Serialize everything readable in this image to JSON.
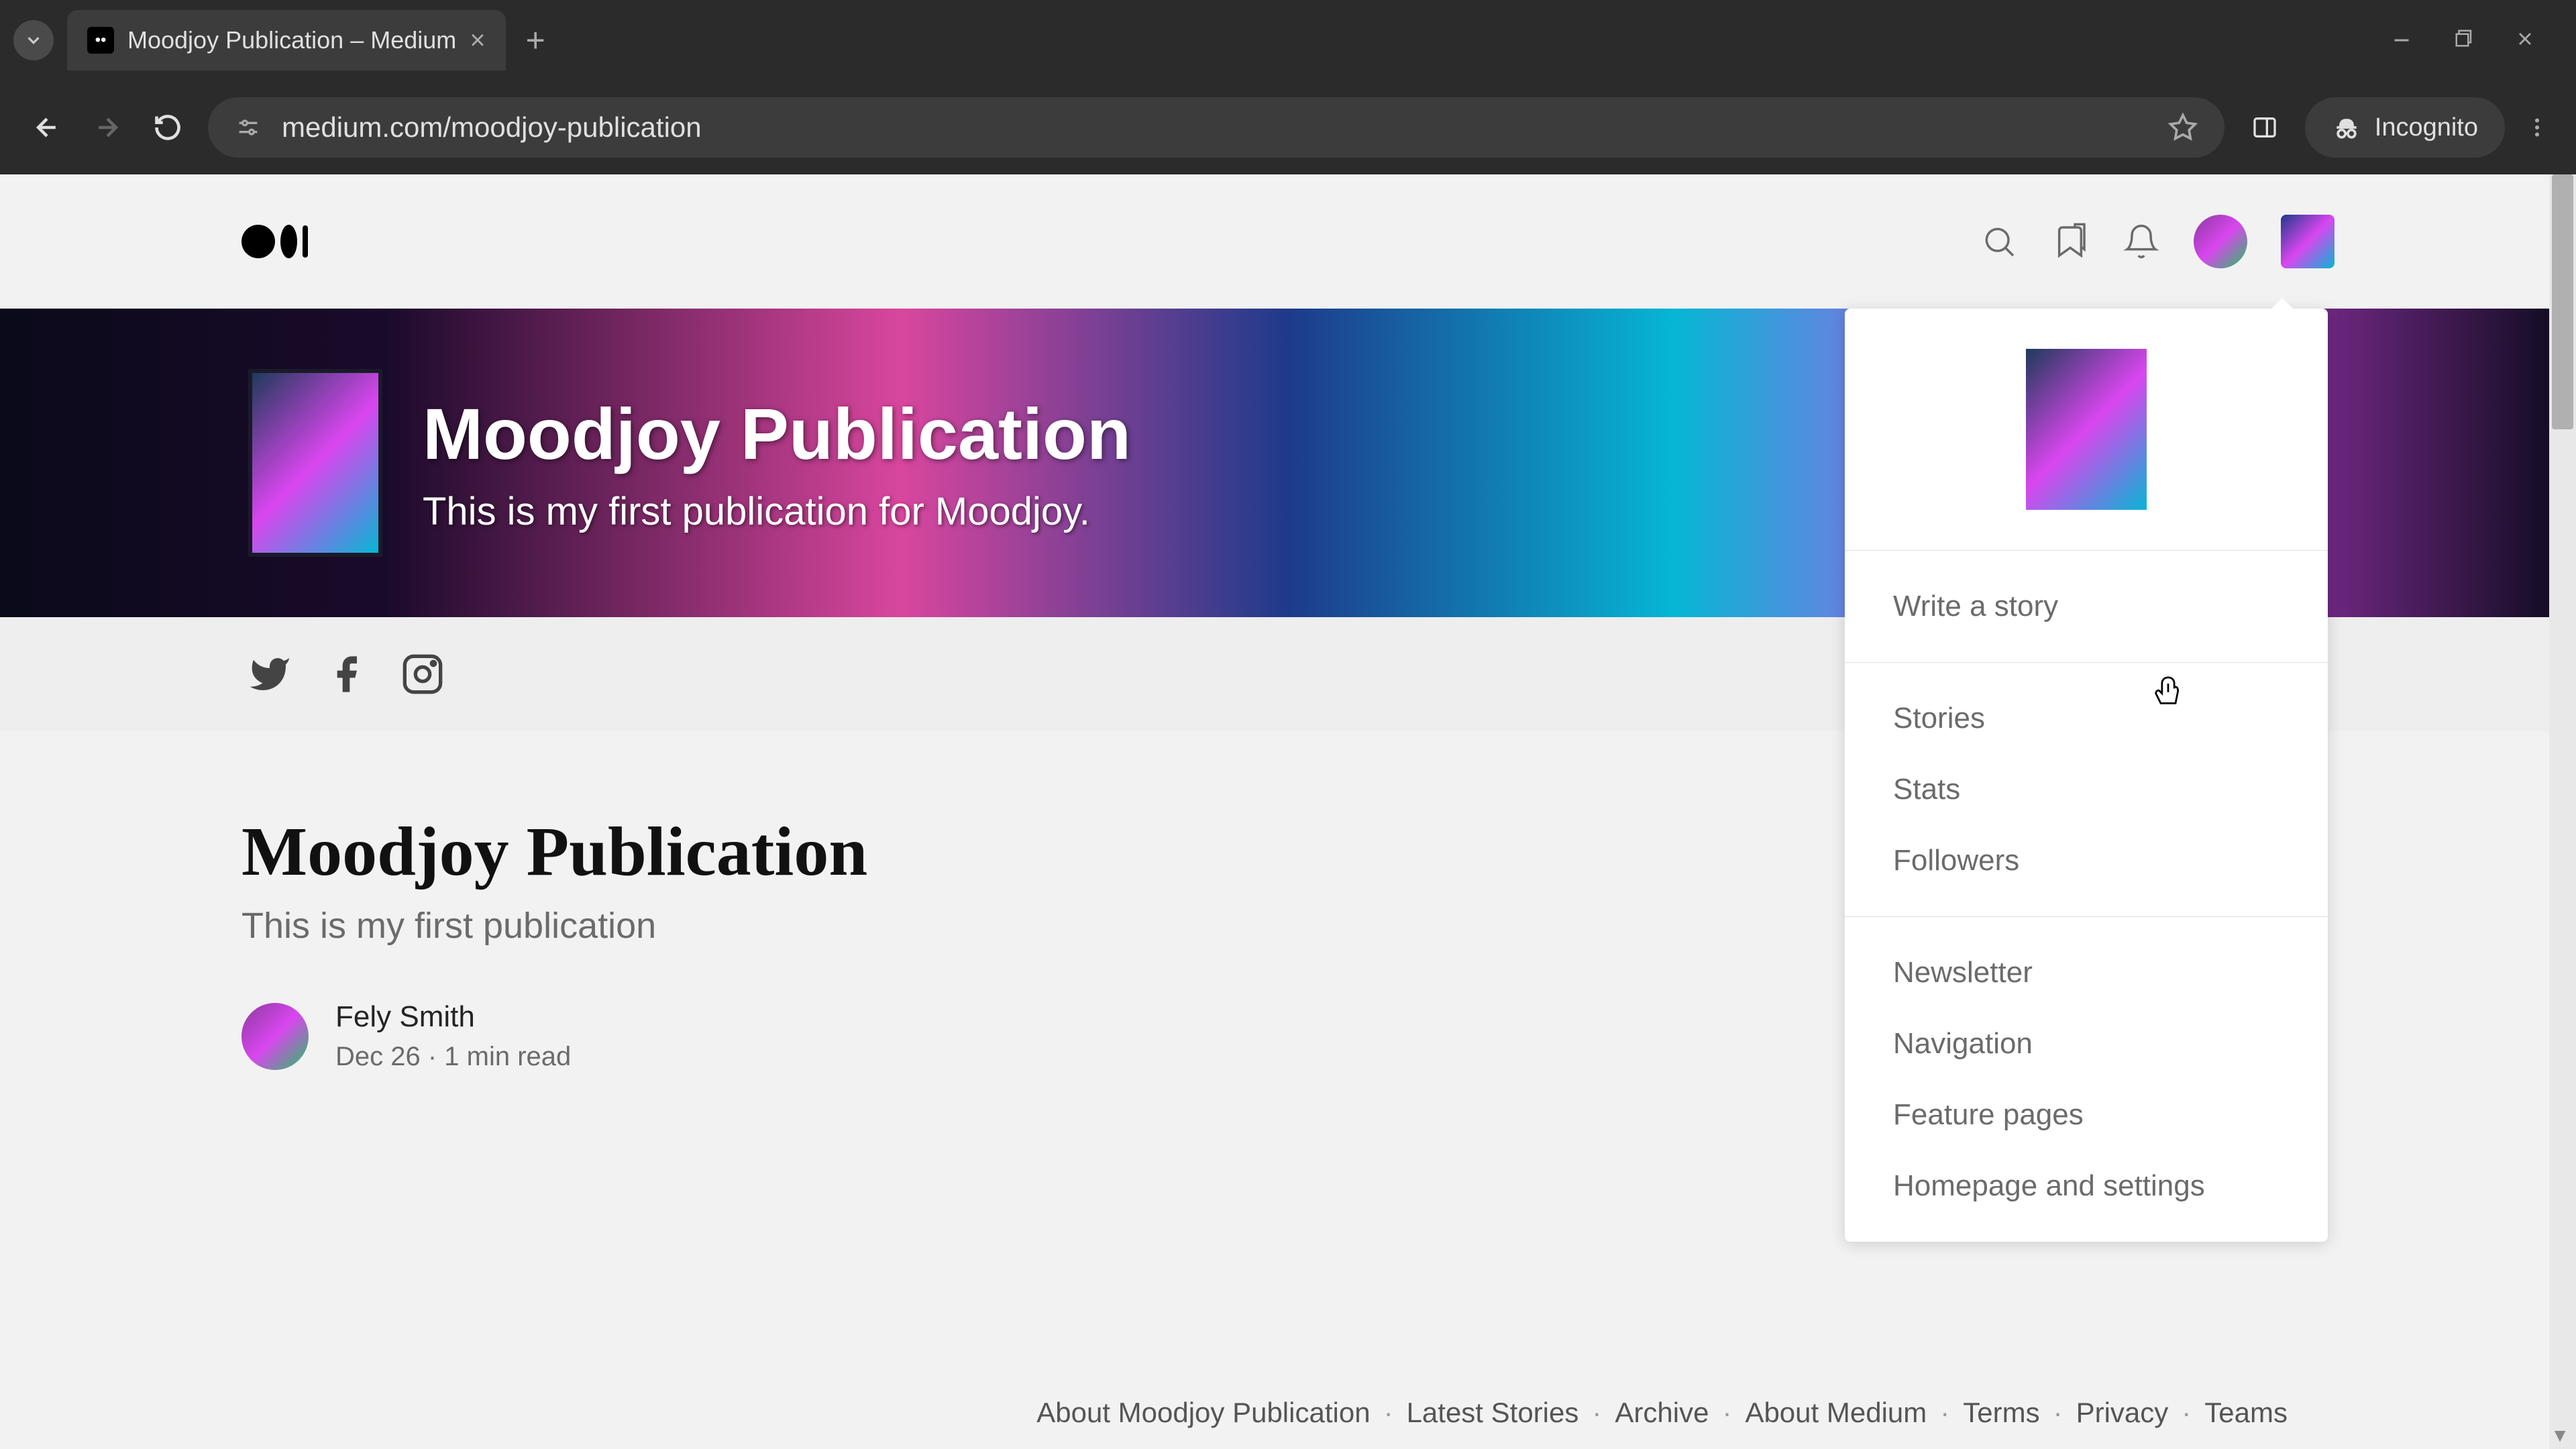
{
  "browser": {
    "tab_title": "Moodjoy Publication – Medium",
    "url": "medium.com/moodjoy-publication",
    "incognito_label": "Incognito"
  },
  "hero": {
    "title": "Moodjoy Publication",
    "subtitle": "This is my first publication for Moodjoy."
  },
  "article": {
    "title": "Moodjoy Publication",
    "subtitle": "This is my first publication",
    "author": "Fely Smith",
    "date": "Dec 26",
    "read_time": "1 min read"
  },
  "dropdown": {
    "write_story": "Write a story",
    "section2": [
      "Stories",
      "Stats",
      "Followers"
    ],
    "section3": [
      "Newsletter",
      "Navigation",
      "Feature pages",
      "Homepage and settings"
    ]
  },
  "footer": {
    "links": [
      "About Moodjoy Publication",
      "Latest Stories",
      "Archive",
      "About Medium",
      "Terms",
      "Privacy",
      "Teams"
    ]
  }
}
